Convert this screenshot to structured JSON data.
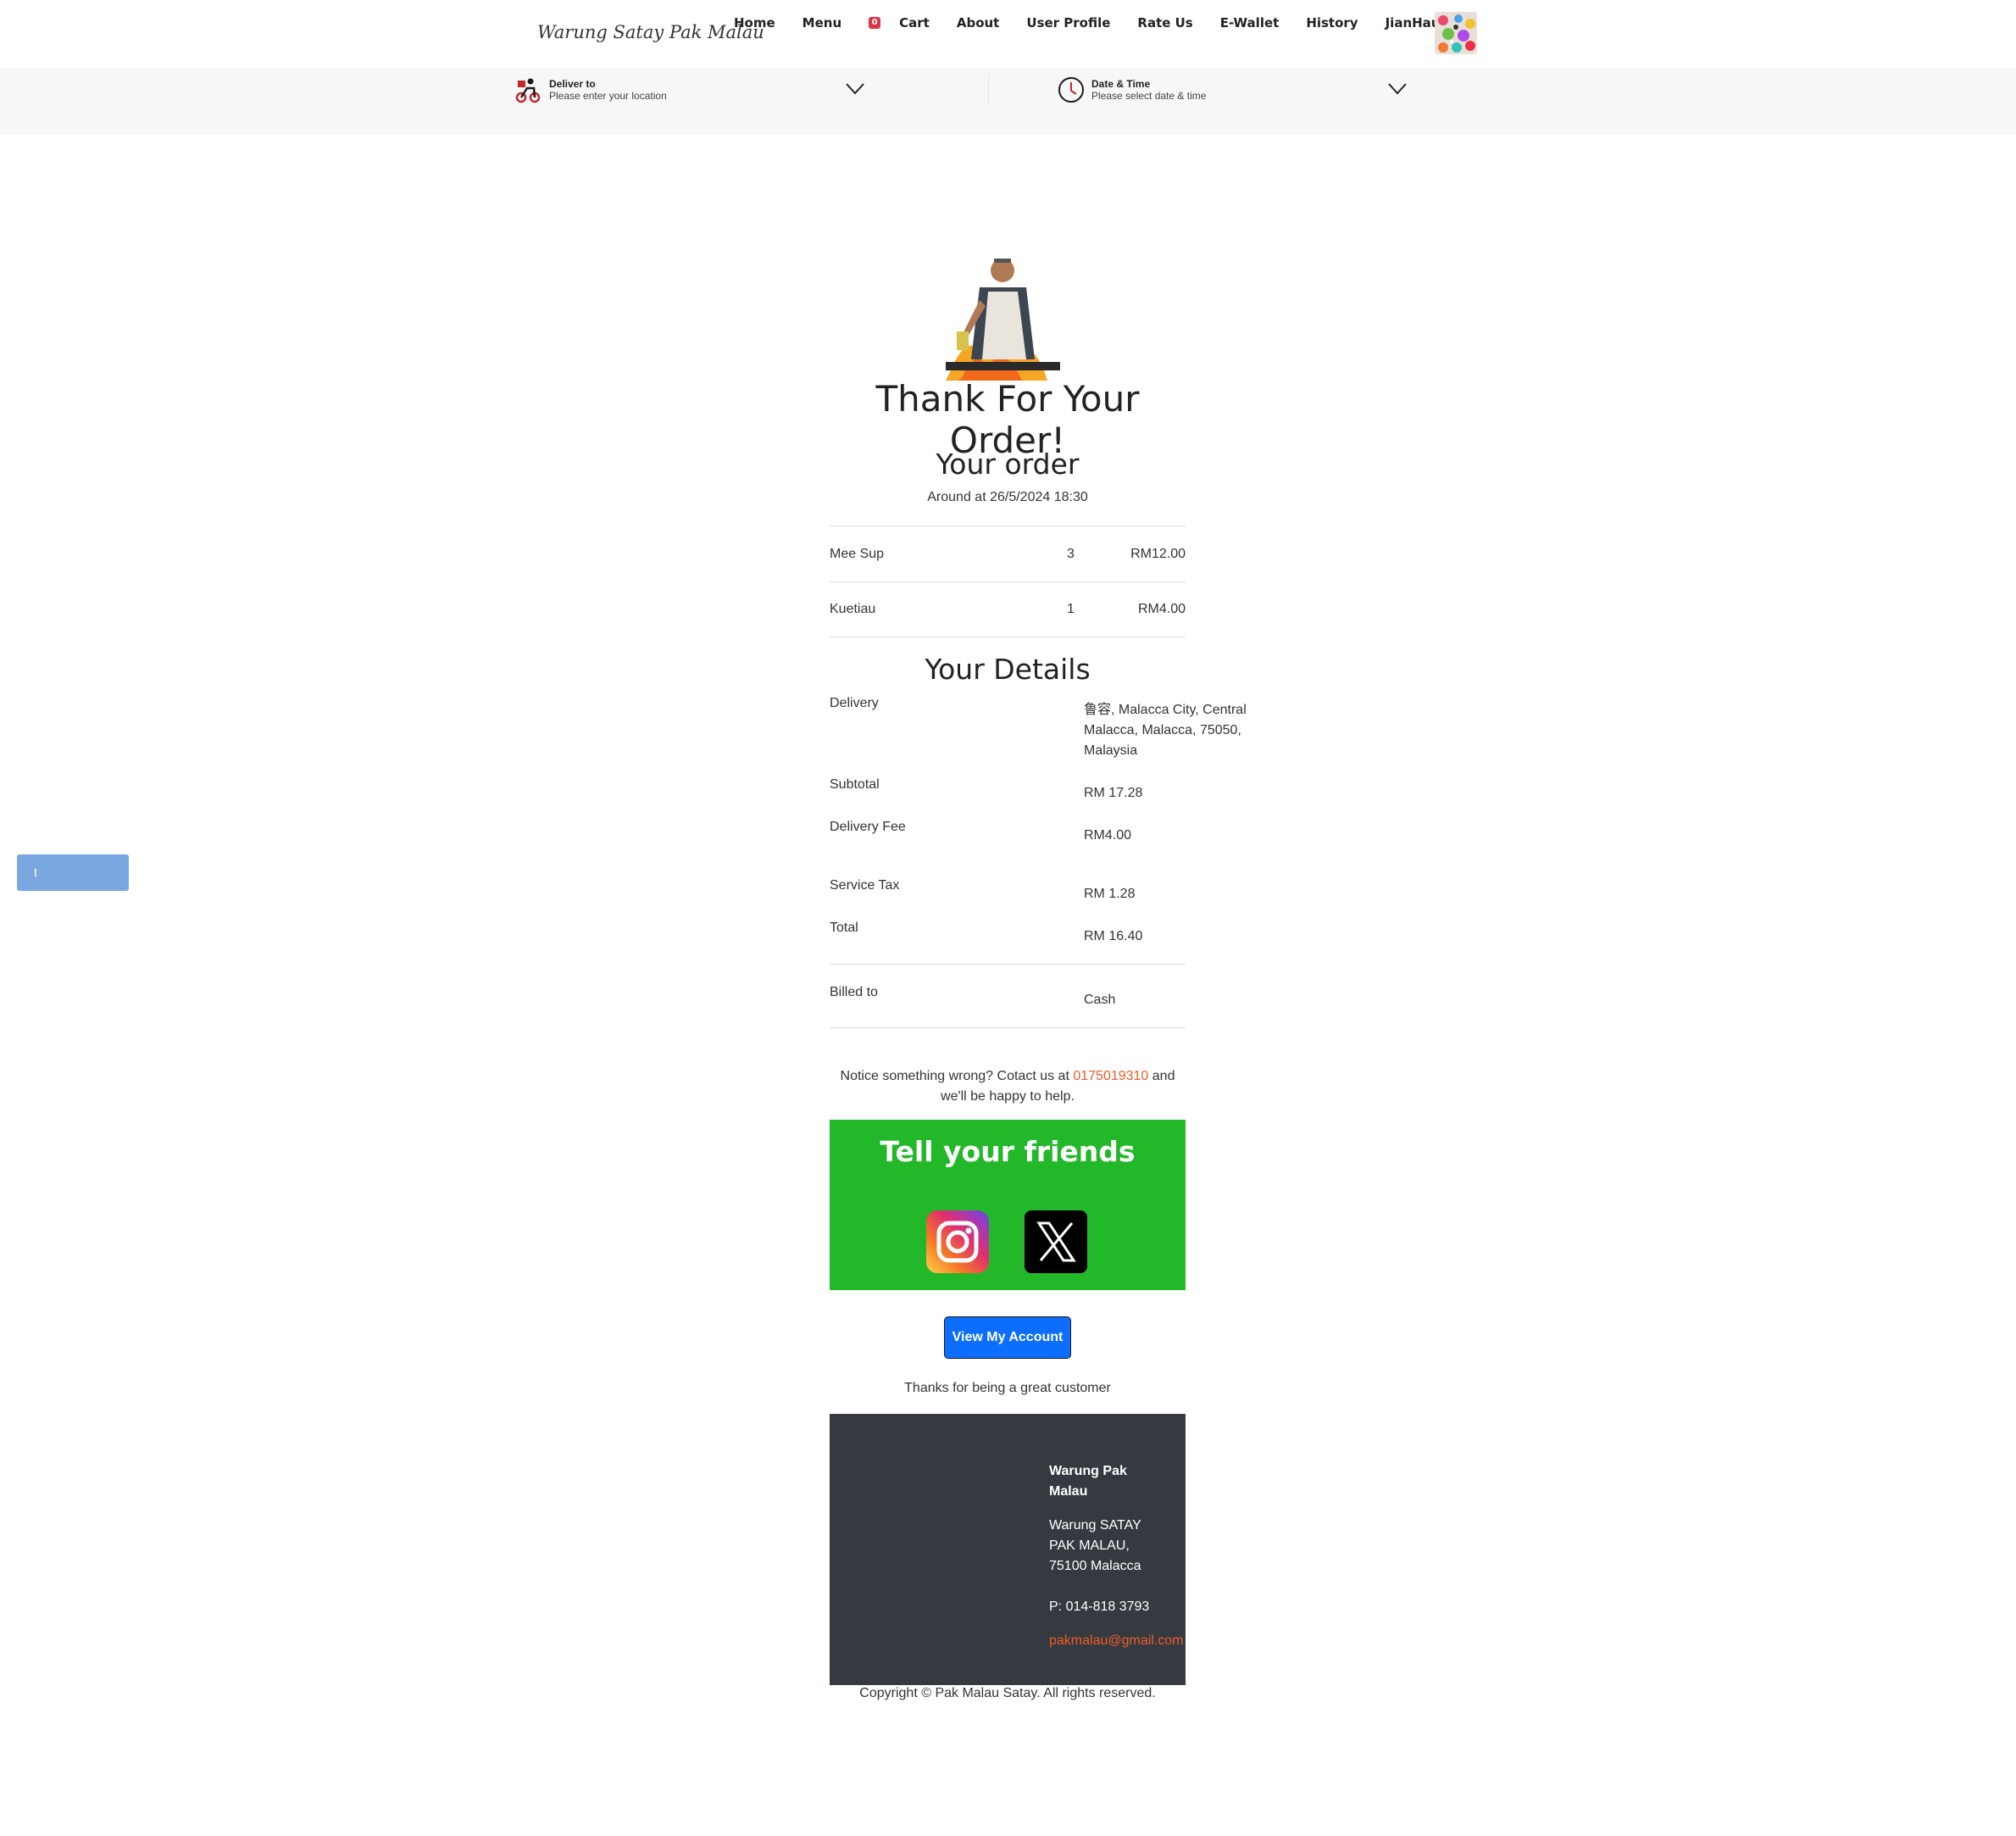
{
  "header": {
    "brand": "Warung Satay Pak Malau",
    "nav": {
      "home": "Home",
      "menu": "Menu",
      "cart_count": "0",
      "cart": "Cart",
      "about": "About",
      "user_profile": "User Profile",
      "rate_us": "Rate Us",
      "ewallet": "E-Wallet",
      "history": "History",
      "user_name": "JianHau1 Tan"
    }
  },
  "delivery_bar": {
    "deliver_to_title": "Deliver to",
    "deliver_to_sub": "Please enter your location",
    "datetime_title": "Date & Time",
    "datetime_sub": "Please select date & time"
  },
  "confirmation": {
    "heading": "Thank For Your Order!",
    "order_heading": "Your order",
    "order_time": "Around at 26/5/2024 18:30",
    "items": [
      {
        "name": "Mee Sup",
        "qty": "3",
        "price": "RM12.00"
      },
      {
        "name": "Kuetiau",
        "qty": "1",
        "price": "RM4.00"
      }
    ],
    "details_heading": "Your Details",
    "details": {
      "delivery_label": "Delivery",
      "delivery_value": "鲁容, Malacca City, Central Malacca, Malacca, 75050, Malaysia",
      "subtotal_label": "Subtotal",
      "subtotal_value": "RM 17.28",
      "delivery_fee_label": "Delivery Fee",
      "delivery_fee_value": "RM4.00",
      "service_tax_label": "Service Tax",
      "service_tax_value": "RM 1.28",
      "total_label": "Total",
      "total_value": "RM 16.40",
      "billed_label": "Billed to",
      "billed_value": "Cash"
    },
    "notice_before": "Notice something wrong? Cotact us at ",
    "notice_phone": "0175019310",
    "notice_after": " and we'll be happy to help.",
    "share_title": "Tell your friends",
    "view_account": "View My Account",
    "thanks_customer": "Thanks for being a great customer"
  },
  "footer": {
    "name": "Warung Pak Malau",
    "address": "Warung SATAY PAK MALAU, 75100 Malacca",
    "phone": "P: 014-818 3793",
    "email": "pakmalau@gmail.com",
    "copyright": "Copyright © Pak Malau Satay. All rights reserved."
  },
  "side_button": {
    "label": "t"
  },
  "colors": {
    "share_bg": "#23b82a",
    "primary_button": "#0d6efd",
    "footer_bg": "#343a40",
    "accent_link": "#f05a28",
    "cart_badge": "#dc3545"
  },
  "icons": [
    "scooter-icon",
    "clock-icon",
    "chevron-down-icon",
    "instagram-icon",
    "x-twitter-icon"
  ]
}
